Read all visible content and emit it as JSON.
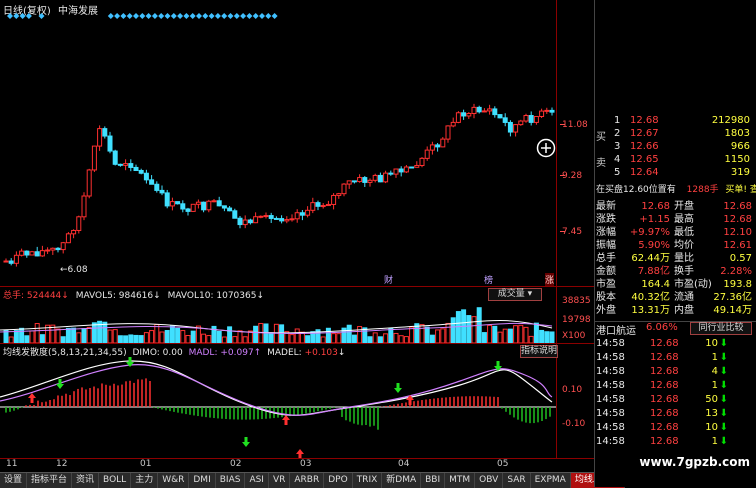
{
  "chart_header": {
    "title": "日线(复权)",
    "stock_name": "中海发展"
  },
  "price_axis": {
    "ticks": [
      "11.08",
      "9.28",
      "7.45"
    ]
  },
  "price_low_label": "6.08",
  "event_markers": [
    "财",
    "榜",
    "涨"
  ],
  "volume_header": {
    "total_label": "总手:",
    "total_value": "524444",
    "mavol5_label": "MAVOL5:",
    "mavol5_value": "984616",
    "mavol10_label": "MAVOL10:",
    "mavol10_value": "1070365",
    "dropdown": "成交量"
  },
  "volume_axis": {
    "ticks": [
      "38835",
      "19798",
      "X100"
    ]
  },
  "indicator_header": {
    "name": "均线发散度(5,8,13,21,34,55)",
    "dimo_label": "DIMO:",
    "dimo_value": "0.00",
    "madl_label": "MADL:",
    "madl_value": "+0.097",
    "madel_label": "MADEL:",
    "madel_value": "+0.103",
    "help_button": "指标说明"
  },
  "indicator_axis": {
    "ticks": [
      "0.10",
      "-0.10"
    ]
  },
  "time_axis": {
    "ticks": [
      "11",
      "12",
      "01",
      "02",
      "03",
      "04",
      "05"
    ]
  },
  "tabs": [
    "设置",
    "指标平台",
    "资讯",
    "BOLL",
    "主力",
    "W&R",
    "DMI",
    "BIAS",
    "ASI",
    "VR",
    "ARBR",
    "DPO",
    "TRIX",
    "新DMA",
    "BBI",
    "MTM",
    "OBV",
    "SAR",
    "EXPMA",
    "均线发散度"
  ],
  "order_book": {
    "sell_label": "卖",
    "buy_label": "买",
    "buy_levels": [
      {
        "level": "1",
        "price": "12.68",
        "volume": "212980"
      },
      {
        "level": "2",
        "price": "12.67",
        "volume": "1803"
      },
      {
        "level": "3",
        "price": "12.66",
        "volume": "966"
      },
      {
        "level": "4",
        "price": "12.65",
        "volume": "1150"
      },
      {
        "level": "5",
        "price": "12.64",
        "volume": "319"
      }
    ],
    "extra_line": "在买盘12.60位置有",
    "extra_volume": "1288手",
    "extra_link": "买单! 查看详细"
  },
  "quote_stats": [
    {
      "l1": "最新",
      "v1": "12.68",
      "l2": "开盘",
      "v2": "12.68"
    },
    {
      "l1": "涨跌",
      "v1": "+1.15",
      "l2": "最高",
      "v2": "12.68"
    },
    {
      "l1": "涨幅",
      "v1": "+9.97%",
      "l2": "最低",
      "v2": "12.10"
    },
    {
      "l1": "振幅",
      "v1": "5.90%",
      "l2": "均价",
      "v2": "12.61"
    },
    {
      "l1": "总手",
      "v1": "62.44万",
      "l2": "量比",
      "v2": "0.57"
    },
    {
      "l1": "金额",
      "v1": "7.88亿",
      "l2": "换手",
      "v2": "2.28%"
    },
    {
      "l1": "市盈",
      "v1": "164.4",
      "l2": "市盈(动)",
      "v2": "193.8"
    },
    {
      "l1": "股本",
      "v1": "40.32亿",
      "l2": "流通",
      "v2": "27.36亿"
    },
    {
      "l1": "外盘",
      "v1": "13.31万",
      "l2": "内盘",
      "v2": "49.14万"
    }
  ],
  "sector": {
    "name": "港口航运",
    "change": "6.06%",
    "button": "同行业比较"
  },
  "ticks": [
    {
      "time": "14:58",
      "price": "12.68",
      "vol": "10"
    },
    {
      "time": "14:58",
      "price": "12.68",
      "vol": "1"
    },
    {
      "time": "14:58",
      "price": "12.68",
      "vol": "4"
    },
    {
      "time": "14:58",
      "price": "12.68",
      "vol": "1"
    },
    {
      "time": "14:58",
      "price": "12.68",
      "vol": "50"
    },
    {
      "time": "14:58",
      "price": "12.68",
      "vol": "13"
    },
    {
      "time": "14:58",
      "price": "12.68",
      "vol": "10"
    },
    {
      "time": "14:58",
      "price": "12.68",
      "vol": "1"
    }
  ],
  "watermark": "www.7gpzb.com",
  "colors": {
    "up": "#ff3030",
    "down": "#40e0ff",
    "grid": "#8b0000",
    "bg": "#000000"
  }
}
